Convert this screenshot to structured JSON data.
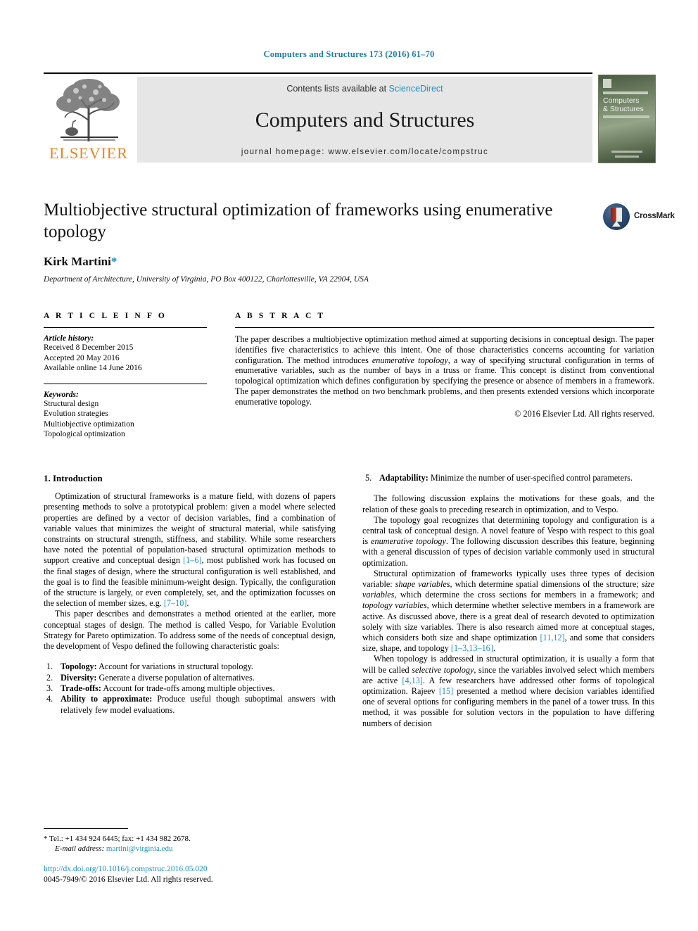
{
  "running_head": "Computers and Structures 173 (2016) 61–70",
  "masthead": {
    "contents_prefix": "Contents lists available at ",
    "sciencedirect": "ScienceDirect",
    "journal_title": "Computers and Structures",
    "homepage": "journal homepage: www.elsevier.com/locate/compstruc",
    "publisher_logo_text": "ELSEVIER",
    "cover": {
      "name_line1": "Computers",
      "name_line2": "& Structures"
    }
  },
  "article": {
    "title": "Multiobjective structural optimization of frameworks using enumerative topology",
    "crossmark_label": "CrossMark",
    "author": "Kirk Martini",
    "author_mark": "*",
    "affiliation": "Department of Architecture, University of Virginia, PO Box 400122, Charlottesville, VA 22904, USA"
  },
  "article_info": {
    "heading": "A R T I C L E   I N F O",
    "history_label": "Article history:",
    "history": [
      "Received 8 December 2015",
      "Accepted 20 May 2016",
      "Available online 14 June 2016"
    ],
    "keywords_label": "Keywords:",
    "keywords": [
      "Structural design",
      "Evolution strategies",
      "Multiobjective optimization",
      "Topological optimization"
    ]
  },
  "abstract": {
    "heading": "A B S T R A C T",
    "text_part1": "The paper describes a multiobjective optimization method aimed at supporting decisions in conceptual design. The paper identifies five characteristics to achieve this intent. One of those characteristics concerns accounting for variation configuration. The method introduces ",
    "em1": "enumerative topology",
    "text_part2": ", a way of specifying structural configuration in terms of enumerative variables, such as the number of bays in a truss or frame. This concept is distinct from conventional topological optimization which defines configuration by specifying the presence or absence of members in a framework. The paper demonstrates the method on two benchmark problems, and then presents extended versions which incorporate enumerative topology.",
    "copyright": "© 2016 Elsevier Ltd. All rights reserved."
  },
  "body": {
    "section_heading": "1. Introduction",
    "left": {
      "p1_a": "Optimization of structural frameworks is a mature field, with dozens of papers presenting methods to solve a prototypical problem: given a model where selected properties are defined by a vector of decision variables, find a combination of variable values that minimizes the weight of structural material, while satisfying constraints on structural strength, stiffness, and stability. While some researchers have noted the potential of population-based structural optimization methods to support creative and conceptual design ",
      "p1_ref1": "[1–6]",
      "p1_b": ", most published work has focused on the final stages of design, where the structural configuration is well established, and the goal is to find the feasible minimum-weight design. Typically, the configuration of the structure is largely, or even completely, set, and the optimization focusses on the selection of member sizes, e.g. ",
      "p1_ref2": "[7–10]",
      "p1_c": ".",
      "p2": "This paper describes and demonstrates a method oriented at the earlier, more conceptual stages of design. The method is called Vespo, for Variable Evolution Strategy for Pareto optimization. To address some of the needs of conceptual design, the development of Vespo defined the following characteristic goals:",
      "goals": [
        {
          "num": "1.",
          "label": "Topology:",
          "text": " Account for variations in structural topology."
        },
        {
          "num": "2.",
          "label": "Diversity:",
          "text": " Generate a diverse population of alternatives."
        },
        {
          "num": "3.",
          "label": "Trade-offs:",
          "text": " Account for trade-offs among multiple objectives."
        },
        {
          "num": "4.",
          "label": "Ability to approximate:",
          "text": " Produce useful though suboptimal answers with relatively few model evaluations."
        }
      ]
    },
    "right": {
      "goal5": {
        "num": "5.",
        "label": "Adaptability:",
        "text": " Minimize the number of user-specified control parameters."
      },
      "p1": "The following discussion explains the motivations for these goals, and the relation of these goals to preceding research in optimization, and to Vespo.",
      "p2_a": "The topology goal recognizes that determining topology and configuration is a central task of conceptual design. A novel feature of Vespo with respect to this goal is ",
      "p2_em": "enumerative topology",
      "p2_b": ". The following discussion describes this feature, beginning with a general discussion of types of decision variable commonly used in structural optimization.",
      "p3_a": "Structural optimization of frameworks typically uses three types of decision variable: ",
      "p3_em1": "shape variables",
      "p3_b": ", which determine spatial dimensions of the structure; ",
      "p3_em2": "size variables",
      "p3_c": ", which determine the cross sections for members in a framework; and ",
      "p3_em3": "topology variables",
      "p3_d": ", which determine whether selective members in a framework are active. As discussed above, there is a great deal of research devoted to optimization solely with size variables. There is also research aimed more at conceptual stages, which considers both size and shape optimization ",
      "p3_ref1": "[11,12]",
      "p3_e": ", and some that considers size, shape, and topology ",
      "p3_ref2": "[1–3,13–16]",
      "p3_f": ".",
      "p4_a": "When topology is addressed in structural optimization, it is usually a form that will be called ",
      "p4_em": "selective topology",
      "p4_b": ", since the variables involved select which members are active ",
      "p4_ref1": "[4,13]",
      "p4_c": ". A few researchers have addressed other forms of topological optimization. Rajeev ",
      "p4_ref2": "[15]",
      "p4_d": " presented a method where decision variables identified one of several options for configuring members in the panel of a tower truss. In this method, it was possible for solution vectors in the population to have differing numbers of decision"
    }
  },
  "footnote": {
    "mark": "*",
    "tel": " Tel.: +1 434 924 6445; fax: +1 434 982 2678.",
    "email_label": "E-mail address:",
    "email": " martini@virginia.edu"
  },
  "doi": {
    "url": "http://dx.doi.org/10.1016/j.compstruc.2016.05.020",
    "issn_line": "0045-7949/© 2016 Elsevier Ltd. All rights reserved."
  },
  "colors": {
    "link": "#1b8fc4",
    "running_head": "#1b7fa8",
    "elsevier_orange": "#f08221",
    "masthead_bg": "#e6e6e6"
  }
}
